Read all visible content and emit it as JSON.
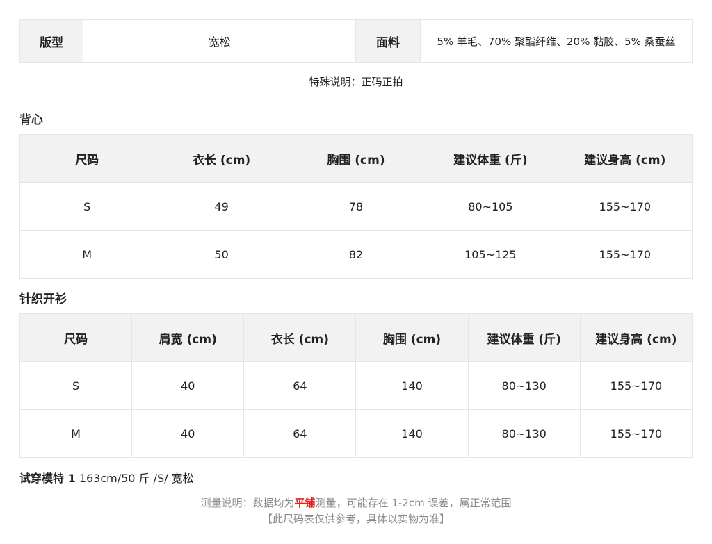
{
  "info": {
    "fit_label": "版型",
    "fit_value": "宽松",
    "fabric_label": "面料",
    "fabric_value": "5% 羊毛、70% 聚酯纤维、20% 黏胶、5% 桑蚕丝"
  },
  "special_note": "特殊说明：正码正拍",
  "vest": {
    "title": "背心",
    "headers": [
      "尺码",
      "衣长 (cm)",
      "胸围 (cm)",
      "建议体重 (斤)",
      "建议身高 (cm)"
    ],
    "rows": [
      [
        "S",
        "49",
        "78",
        "80~105",
        "155~170"
      ],
      [
        "M",
        "50",
        "82",
        "105~125",
        "155~170"
      ]
    ]
  },
  "cardigan": {
    "title": "针织开衫",
    "headers": [
      "尺码",
      "肩宽 (cm)",
      "衣长 (cm)",
      "胸围 (cm)",
      "建议体重 (斤)",
      "建议身高 (cm)"
    ],
    "rows": [
      [
        "S",
        "40",
        "64",
        "140",
        "80~130",
        "155~170"
      ],
      [
        "M",
        "40",
        "64",
        "140",
        "80~130",
        "155~170"
      ]
    ]
  },
  "model": {
    "label": "试穿模特 1",
    "value": "163cm/50 斤 /S/ 宽松"
  },
  "measure_note": {
    "prefix": "测量说明：数据均为",
    "highlight": "平铺",
    "suffix": "测量，可能存在 1-2cm 误差，属正常范围",
    "line2": "【此尺码表仅供参考，具体以实物为准】"
  },
  "colors": {
    "header_bg": "#f2f2f2",
    "border": "#e6e6e6",
    "note_gray": "#8a8a8a",
    "highlight_red": "#e02020"
  }
}
